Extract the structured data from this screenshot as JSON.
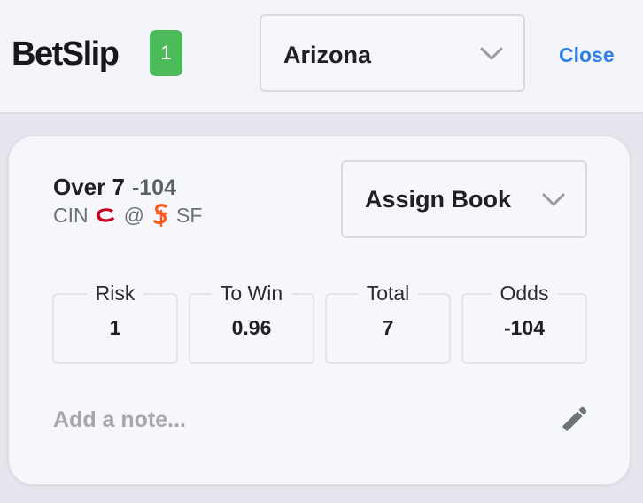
{
  "header": {
    "brand": "BetSlip",
    "count": "1",
    "state_select": {
      "value": "Arizona",
      "icon": "chevron-down-icon"
    },
    "close_label": "Close"
  },
  "bet": {
    "pick": "Over 7",
    "odds": "-104",
    "away_team": "CIN",
    "away_logo": "reds-logo",
    "at": "@",
    "home_logo": "giants-logo",
    "home_team": "SF",
    "book_select": {
      "value": "Assign Book",
      "icon": "chevron-down-icon"
    },
    "stats": [
      {
        "label": "Risk",
        "value": "1"
      },
      {
        "label": "To Win",
        "value": "0.96"
      },
      {
        "label": "Total",
        "value": "7"
      },
      {
        "label": "Odds",
        "value": "-104"
      }
    ],
    "note_placeholder": "Add a note...",
    "note_icon": "pencil-icon"
  },
  "colors": {
    "badge": "#4cbb59",
    "link": "#2f7fe4",
    "reds": "#c6011f",
    "giants": "#fd5a1e"
  }
}
